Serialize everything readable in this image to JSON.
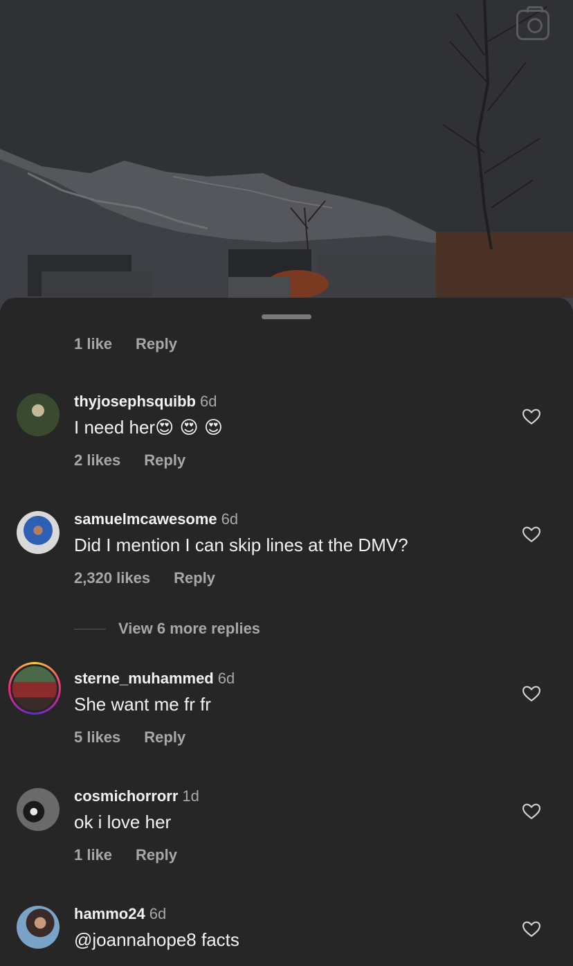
{
  "top_meta": {
    "likes": "1 like",
    "reply": "Reply"
  },
  "comments": [
    {
      "username": "thyjosephsquibb",
      "time": "6d",
      "text": "I need her",
      "emojis": "😍 😍 😍",
      "likes": "2 likes",
      "reply": "Reply",
      "avatar_colors": [
        "#3a4a30",
        "#c8b89a"
      ]
    },
    {
      "username": "samuelmcawesome",
      "time": "6d",
      "text": "Did I mention I can skip lines at the DMV?",
      "likes": "2,320 likes",
      "reply": "Reply",
      "avatar_colors": [
        "#d9d9d9",
        "#2d5fb3"
      ]
    },
    {
      "username": "sterne_muhammed",
      "time": "6d",
      "text": "She want me fr fr",
      "likes": "5 likes",
      "reply": "Reply",
      "avatar_colors": [
        "#8a2c2c",
        "#4a6a4a"
      ],
      "story_ring": true
    },
    {
      "username": "cosmichorrorr",
      "time": "1d",
      "text": "ok i love her",
      "likes": "1 like",
      "reply": "Reply",
      "avatar_colors": [
        "#6a6a6a",
        "#1a1a1a"
      ]
    },
    {
      "username": "hammo24",
      "time": "6d",
      "text": "@joannahope8 facts",
      "avatar_colors": [
        "#7aa3c8",
        "#3a2a2a"
      ]
    }
  ],
  "view_more": "View 6 more replies",
  "icons": {
    "camera": "camera-icon",
    "like": "heart-outline-icon"
  },
  "colors": {
    "background": "#262626",
    "text": "#f2f2f2",
    "secondary": "#a8a8a8"
  }
}
